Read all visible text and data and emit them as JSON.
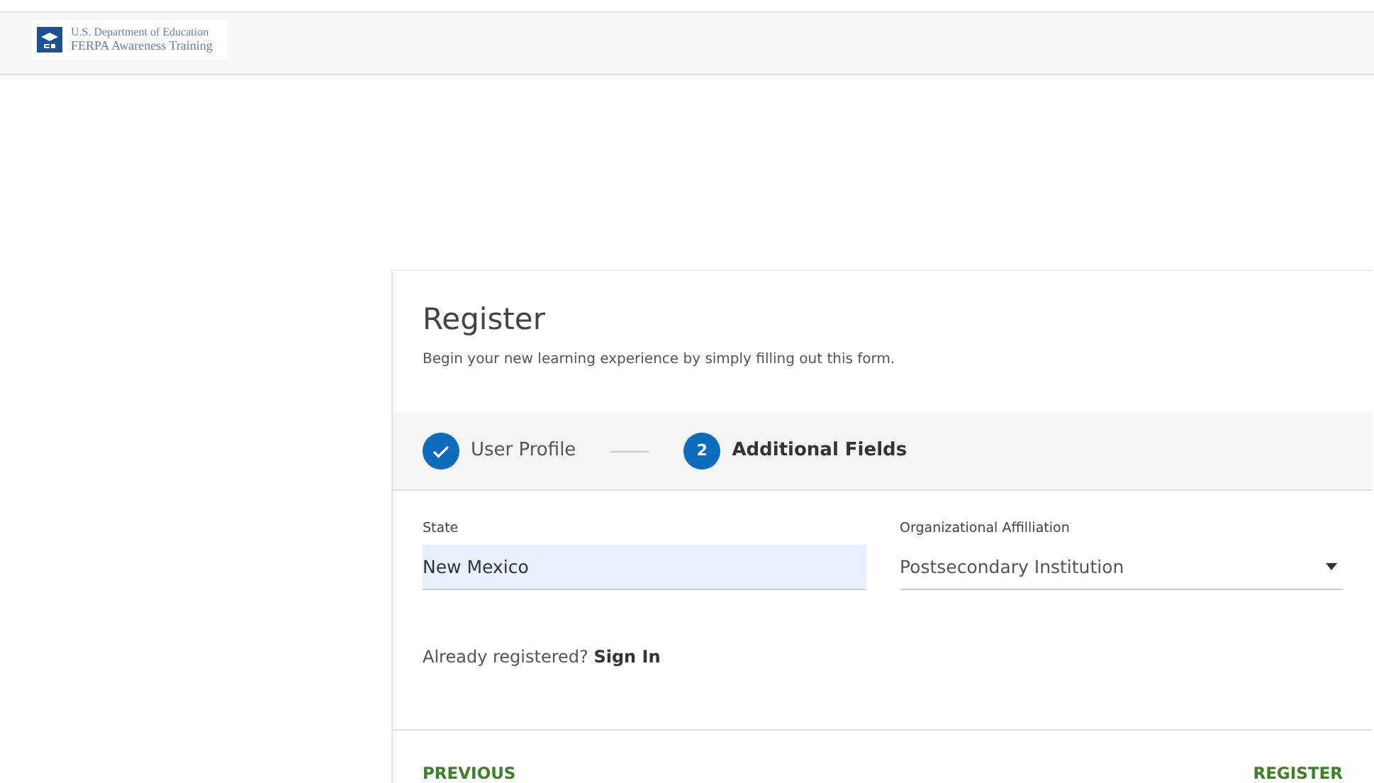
{
  "header": {
    "logo_line_1": "U.S. Department of Education",
    "logo_line_2": "FERPA Awareness Training"
  },
  "form": {
    "title": "Register",
    "subtitle": "Begin your new learning experience by simply filling out this form.",
    "steps": [
      {
        "label": "User Profile",
        "completed": true,
        "selected": false
      },
      {
        "label": "Additional Fields",
        "completed": false,
        "selected": true,
        "number": "2"
      }
    ],
    "fields": [
      {
        "kind": "text",
        "label": "State",
        "value": "New Mexico",
        "autofilled": true
      },
      {
        "kind": "select",
        "label": "Organizational Affilliation",
        "value": "Postsecondary Institution",
        "autofilled": false
      }
    ],
    "signin_prompt": "Already registered?",
    "signin_link": "Sign In",
    "buttons": [
      "PREVIOUS",
      "REGISTER"
    ]
  }
}
